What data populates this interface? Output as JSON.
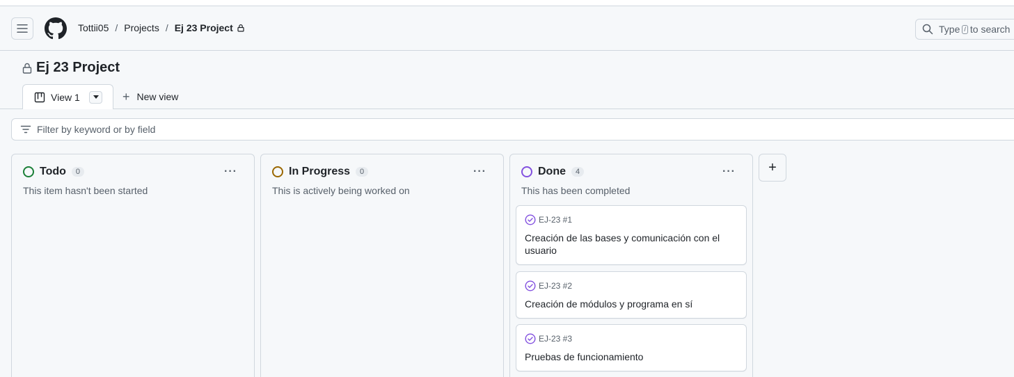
{
  "header": {
    "breadcrumbs": [
      "Tottii05",
      "Projects",
      "Ej 23 Project"
    ],
    "separator": "/",
    "search": {
      "prefix": "Type",
      "key": "/",
      "suffix": "to search"
    }
  },
  "project": {
    "title": "Ej 23 Project"
  },
  "views": {
    "tabs": [
      {
        "label": "View 1"
      }
    ],
    "new_view_label": "New view"
  },
  "filter": {
    "placeholder": "Filter by keyword or by field"
  },
  "columns": [
    {
      "name": "Todo",
      "count": "0",
      "description": "This item hasn't been started",
      "color": "#1a7f37",
      "cards": []
    },
    {
      "name": "In Progress",
      "count": "0",
      "description": "This is actively being worked on",
      "color": "#9a6700",
      "cards": []
    },
    {
      "name": "Done",
      "count": "4",
      "description": "This has been completed",
      "color": "#8250df",
      "cards": [
        {
          "ref": "EJ-23 #1",
          "title": "Creación de las bases y comunicación con el usuario"
        },
        {
          "ref": "EJ-23 #2",
          "title": "Creación de módulos y programa en sí"
        },
        {
          "ref": "EJ-23 #3",
          "title": "Pruebas de funcionamiento"
        }
      ]
    }
  ],
  "more_glyph": "···",
  "add_column_glyph": "+",
  "colors": {
    "done_icon": "#8250df",
    "border": "#d0d7de",
    "muted": "#57606a"
  }
}
